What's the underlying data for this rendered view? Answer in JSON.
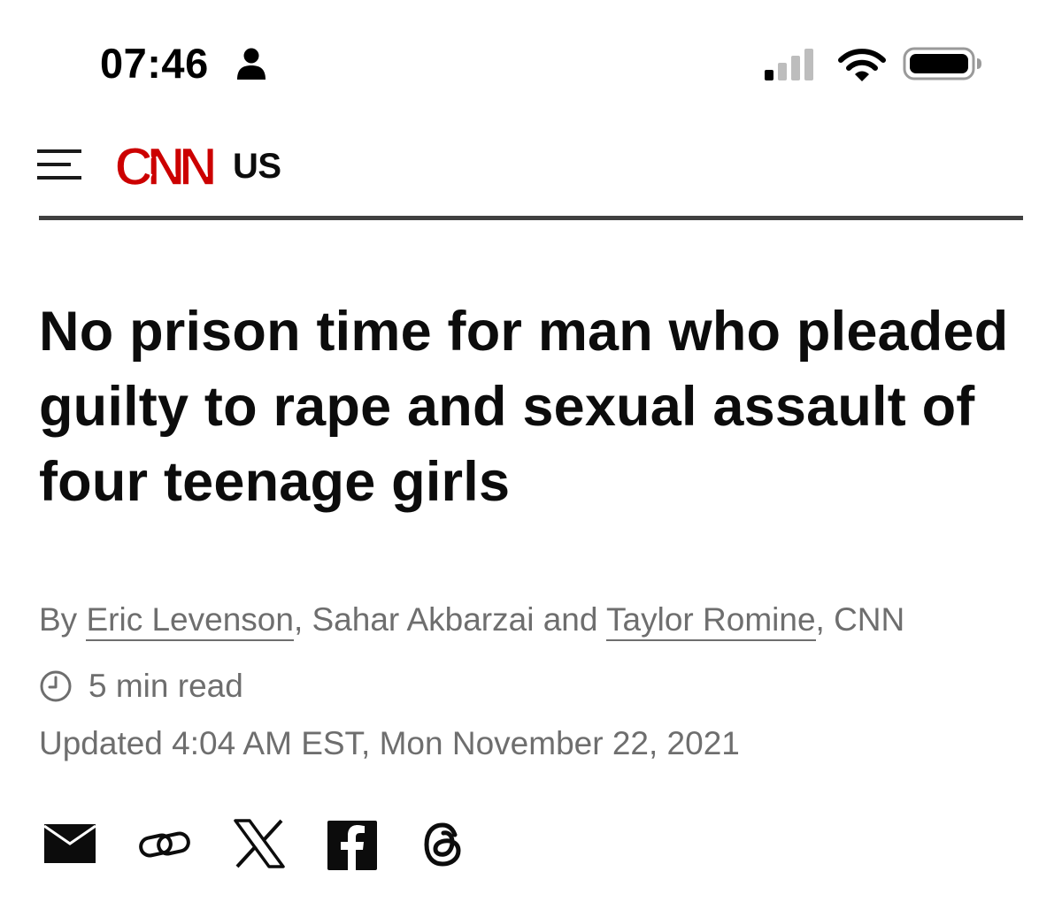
{
  "status_bar": {
    "time": "07:46",
    "icons": [
      "person-icon",
      "cellular-signal-icon",
      "wifi-icon",
      "battery-icon"
    ]
  },
  "header": {
    "menu_icon": "hamburger-menu-icon",
    "logo_text": "CNN",
    "section": "US",
    "brand_color": "#cc0000"
  },
  "article": {
    "headline": "No prison time for man who pleaded guilty to rape and sexual assault of four teenage girls",
    "byline": {
      "prefix": "By ",
      "author_1": "Eric Levenson",
      "sep_1": ", Sahar Akbarzai and ",
      "author_2": "Taylor Romine",
      "suffix": ", CNN"
    },
    "read_time": "5 min read",
    "updated": "Updated 4:04 AM EST, Mon November 22, 2021"
  },
  "share": {
    "icons": [
      "email-icon",
      "link-icon",
      "x-icon",
      "facebook-icon",
      "threads-icon"
    ]
  }
}
